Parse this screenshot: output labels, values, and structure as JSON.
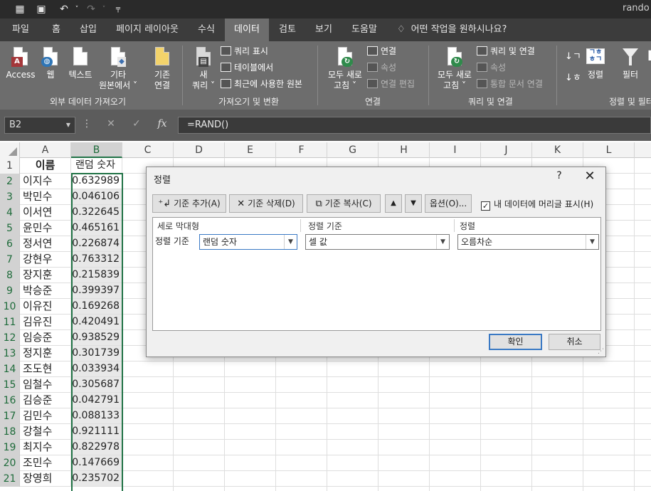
{
  "window": {
    "title": "rando"
  },
  "quick_access": {
    "save_icon": "save-icon",
    "undo_icon": "undo-icon",
    "redo_icon": "redo-icon"
  },
  "tabs": [
    {
      "label": "파일"
    },
    {
      "label": "홈"
    },
    {
      "label": "삽입"
    },
    {
      "label": "페이지 레이아웃"
    },
    {
      "label": "수식"
    },
    {
      "label": "데이터"
    },
    {
      "label": "검토"
    },
    {
      "label": "보기"
    },
    {
      "label": "도움말"
    }
  ],
  "tell_me": "어떤 작업을 원하시나요?",
  "ribbon": {
    "external": {
      "access": "Access",
      "web": "웹",
      "text": "텍스트",
      "other_line1": "기타",
      "other_line2": "원본에서 ˅",
      "existing_line1": "기존",
      "existing_line2": "연결",
      "group_label": "외부 데이터 가져오기"
    },
    "get_transform": {
      "new_query_line1": "새",
      "new_query_line2": "쿼리 ˅",
      "show_queries": "쿼리 표시",
      "from_table": "테이블에서",
      "recent_sources": "최근에 사용한 원본",
      "group_label": "가져오기 및 변환"
    },
    "connections": {
      "refresh_line1": "모두 새로",
      "refresh_line2": "고침 ˅",
      "connections": "연결",
      "properties": "속성",
      "edit_links": "연결 편집",
      "group_label": "연결"
    },
    "queries": {
      "refresh_line1": "모두 새로",
      "refresh_line2": "고침 ˅",
      "queries_connections": "쿼리 및 연결",
      "properties": "속성",
      "workbook_links": "통합 문서 연결",
      "group_label": "쿼리 및 연결"
    },
    "sort_filter": {
      "sort": "정렬",
      "filter": "필터",
      "group_label": "정렬 및 필터"
    }
  },
  "formula_bar": {
    "name_box": "B2",
    "fx": "fx",
    "formula": "=RAND()"
  },
  "columns": [
    "A",
    "B",
    "C",
    "D",
    "E",
    "F",
    "G",
    "H",
    "I",
    "J",
    "K",
    "L"
  ],
  "sheet_rows": [
    {
      "n": "1",
      "a": "이름",
      "b": "랜덤 숫자"
    },
    {
      "n": "2",
      "a": "이지수",
      "b": "0.632989"
    },
    {
      "n": "3",
      "a": "박민수",
      "b": "0.046106"
    },
    {
      "n": "4",
      "a": "이서연",
      "b": "0.322645"
    },
    {
      "n": "5",
      "a": "윤민수",
      "b": "0.465161"
    },
    {
      "n": "6",
      "a": "정서연",
      "b": "0.226874"
    },
    {
      "n": "7",
      "a": "강현우",
      "b": "0.763312"
    },
    {
      "n": "8",
      "a": "장지훈",
      "b": "0.215839"
    },
    {
      "n": "9",
      "a": "박승준",
      "b": "0.399397"
    },
    {
      "n": "10",
      "a": "이유진",
      "b": "0.169268"
    },
    {
      "n": "11",
      "a": "김유진",
      "b": "0.420491"
    },
    {
      "n": "12",
      "a": "임승준",
      "b": "0.938529"
    },
    {
      "n": "13",
      "a": "정지훈",
      "b": "0.301739"
    },
    {
      "n": "14",
      "a": "조도현",
      "b": "0.033934"
    },
    {
      "n": "15",
      "a": "임철수",
      "b": "0.305687"
    },
    {
      "n": "16",
      "a": "김승준",
      "b": "0.042791"
    },
    {
      "n": "17",
      "a": "김민수",
      "b": "0.088133"
    },
    {
      "n": "18",
      "a": "강철수",
      "b": "0.921111"
    },
    {
      "n": "19",
      "a": "최지수",
      "b": "0.822978"
    },
    {
      "n": "20",
      "a": "조민수",
      "b": "0.147669"
    },
    {
      "n": "21",
      "a": "장영희",
      "b": "0.235702"
    }
  ],
  "dialog": {
    "title": "정렬",
    "help": "?",
    "close": "✕",
    "add_level": "기준 추가(A)",
    "delete_level": "기준 삭제(D)",
    "copy_level": "기준 복사(C)",
    "options": "옵션(O)...",
    "header_checkbox": "내 데이터에 머리글 표시(H)",
    "header_checked": true,
    "col_header_column": "세로 막대형",
    "col_header_sorton": "정렬 기준",
    "col_header_order": "정렬",
    "row_label": "정렬 기준",
    "column_value": "랜덤 숫자",
    "sorton_value": "셀 값",
    "order_value": "오름차순",
    "ok": "확인",
    "cancel": "취소"
  }
}
